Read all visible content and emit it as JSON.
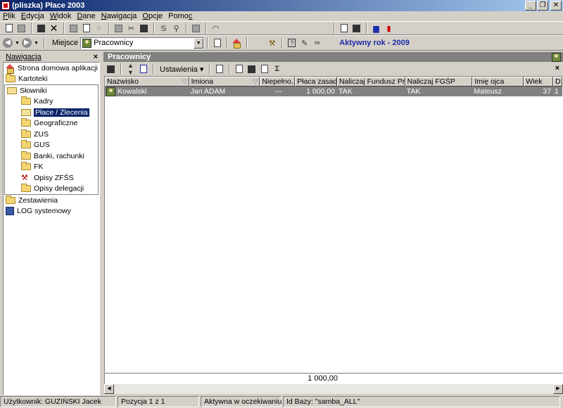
{
  "window": {
    "title": "(pliszka)  Płace 2003",
    "controls": [
      "_",
      "❐",
      "✕"
    ]
  },
  "menu": [
    {
      "u": "P",
      "rest": "lik"
    },
    {
      "u": "E",
      "rest": "dycja"
    },
    {
      "u": "W",
      "rest": "idok"
    },
    {
      "u": "D",
      "rest": "ane"
    },
    {
      "u": "N",
      "rest": "awigacja"
    },
    {
      "u": "O",
      "rest": "pcje"
    },
    {
      "pre": "Pomo",
      "u": "c",
      "rest": ""
    }
  ],
  "toolbar2": {
    "place_label": "Miejsce",
    "place_value": "Pracownicy",
    "active_year": "Aktywny rok - 2009"
  },
  "navigation": {
    "title": "Nawigacja",
    "close": "×",
    "items": [
      {
        "label": "Strona domowa aplikacji",
        "icon": "home-icon"
      },
      {
        "label": "Kartoteki",
        "icon": "folder-icon"
      },
      {
        "label": "Słowniki",
        "icon": "folder-open-icon"
      },
      {
        "label": "Kadry",
        "icon": "folder-icon"
      },
      {
        "label": "Płace / Zlecenia",
        "icon": "folder-open-icon",
        "selected": true
      },
      {
        "label": "Geograficzne",
        "icon": "folder-icon"
      },
      {
        "label": "ZUS",
        "icon": "folder-icon"
      },
      {
        "label": "GUS",
        "icon": "folder-icon"
      },
      {
        "label": "Banki, rachunki",
        "icon": "folder-icon"
      },
      {
        "label": "FK",
        "icon": "folder-icon"
      },
      {
        "label": "Opisy ZFŚS",
        "icon": "tool-icon"
      },
      {
        "label": "Opisy delegacji",
        "icon": "folder-icon"
      },
      {
        "label": "Zestawienia",
        "icon": "folder-icon"
      },
      {
        "label": "LOG systemowy",
        "icon": "log-icon"
      }
    ]
  },
  "main": {
    "title": "Pracownicy",
    "settings_label": "Ustawienia",
    "sigma": "Σ",
    "close": "×",
    "columns": [
      "Nazwisko",
      "Imiona",
      "Niepełno...",
      "Płaca zasad.",
      "Naliczaj Fundusz Pracy",
      "Naliczaj FGŚP",
      "Imię ojca",
      "Wiek",
      "D"
    ],
    "rows": [
      [
        "Kowalski",
        "Jan ADAM",
        "---",
        "1 000,00",
        "TAK",
        "TAK",
        "Mateusz",
        "37",
        "1"
      ]
    ],
    "footer_sum": "1 000,00"
  },
  "status": {
    "user": "Użytkownik: GUZIŃSKI Jacek",
    "position": "Pozycja 1 z 1",
    "state": "Aktywna w oczekiwaniu",
    "db": "Id Bazy: \"samba_ALL\""
  },
  "colors": {
    "title_gradient_start": "#0a246a",
    "title_gradient_end": "#a6caf0",
    "selection": "#0a246a",
    "row_highlight": "#808080",
    "active_year_text": "#1b2ba8"
  }
}
